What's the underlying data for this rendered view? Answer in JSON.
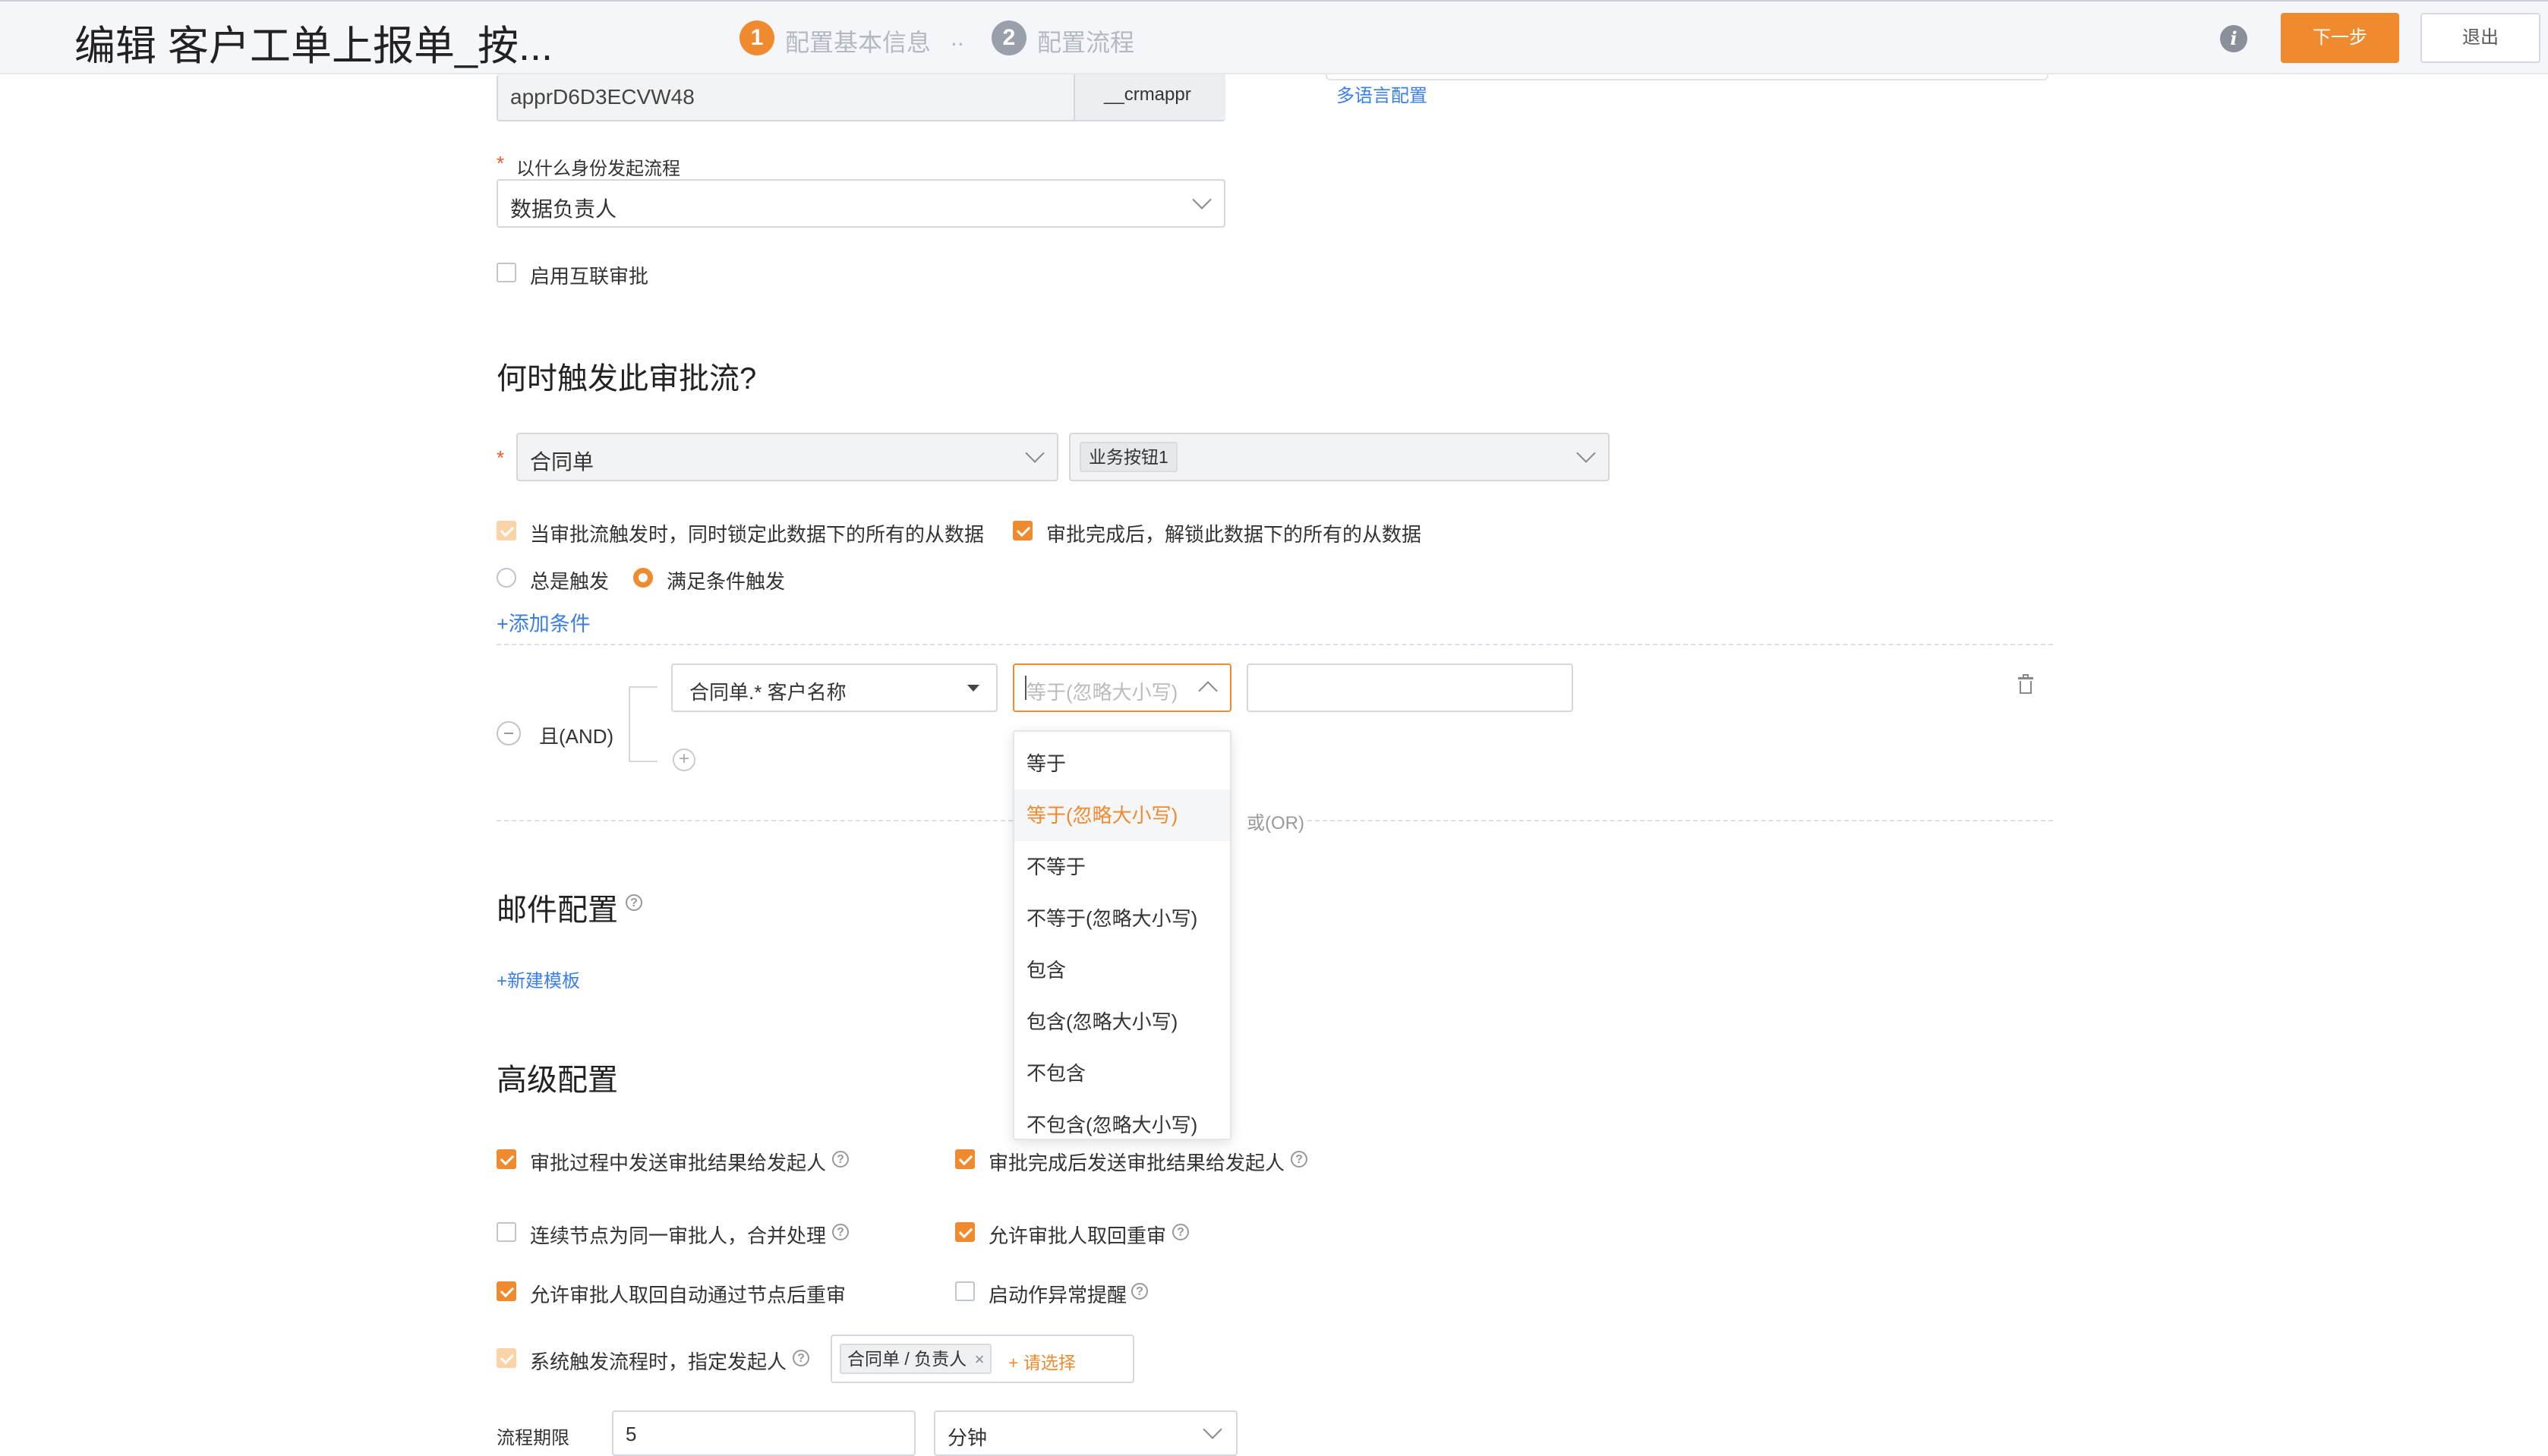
{
  "header": {
    "title": "编辑 客户工单上报单_按...",
    "steps": [
      {
        "num": "1",
        "label": "配置基本信息"
      },
      {
        "num": "2",
        "label": "配置流程"
      }
    ],
    "step_separator": "..",
    "next_label": "下一步",
    "exit_label": "退出"
  },
  "basic": {
    "api_name_value": "apprD6D3ECVW48",
    "api_name_suffix": "__crmappr",
    "multilang_link": "多语言配置",
    "initiator_label": "以什么身份发起流程",
    "initiator_value": "数据负责人",
    "interconnect_label": "启用互联审批"
  },
  "trigger": {
    "title": "何时触发此审批流?",
    "object_value": "合同单",
    "button_tag": "业务按钮1",
    "lock_label": "当审批流触发时，同时锁定此数据下的所有的从数据",
    "unlock_label": "审批完成后，解锁此数据下的所有的从数据",
    "always_label": "总是触发",
    "condition_label": "满足条件触发",
    "add_condition": "+添加条件",
    "and_label": "且(AND)",
    "field_value": "合同单.* 客户名称",
    "operator_placeholder": "等于(忽略大小写)",
    "or_label": "或(OR)",
    "operator_options": [
      "等于",
      "等于(忽略大小写)",
      "不等于",
      "不等于(忽略大小写)",
      "包含",
      "包含(忽略大小写)",
      "不包含",
      "不包含(忽略大小写)"
    ],
    "selected_option_index": 1
  },
  "mail": {
    "title": "邮件配置",
    "new_template": "+新建模板"
  },
  "advanced": {
    "title": "高级配置",
    "options": [
      {
        "label": "审批过程中发送审批结果给发起人",
        "checked": true,
        "help": true
      },
      {
        "label": "审批完成后发送审批结果给发起人",
        "checked": true,
        "help": true
      },
      {
        "label": "连续节点为同一审批人，合并处理",
        "checked": false,
        "help": true
      },
      {
        "label": "允许审批人取回重审",
        "checked": true,
        "help": true
      },
      {
        "label": "允许审批人取回自动通过节点后重审",
        "checked": true,
        "help": false
      },
      {
        "label": "启动作异常提醒",
        "checked": false,
        "help": true
      },
      {
        "label": "系统触发流程时，指定发起人",
        "checked": true,
        "help": true
      }
    ],
    "initiator_tag": "合同单 / 负责人",
    "please_select": "+ 请选择",
    "deadline_label": "流程期限",
    "deadline_value": "5",
    "deadline_unit": "分钟"
  }
}
